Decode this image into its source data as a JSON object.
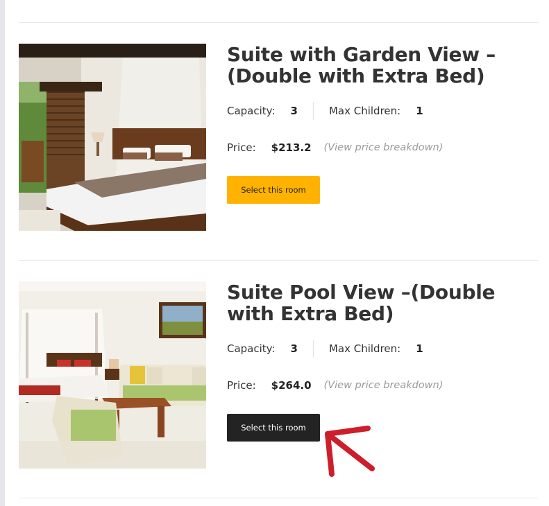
{
  "rooms": [
    {
      "title": "Suite with Garden View –(Double with Extra Bed)",
      "capacity_label": "Capacity:",
      "capacity_value": "3",
      "max_children_label": "Max Children:",
      "max_children_value": "1",
      "price_label": "Price:",
      "price_value": "$213.2",
      "breakdown_link": "(View price breakdown)",
      "button_label": "Select this room",
      "button_color": "#ffb300"
    },
    {
      "title": "Suite Pool View –(Double with Extra Bed)",
      "capacity_label": "Capacity:",
      "capacity_value": "3",
      "max_children_label": "Max Children:",
      "max_children_value": "1",
      "price_label": "Price:",
      "price_value": "$264.0",
      "breakdown_link": "(View price breakdown)",
      "button_label": "Select this room",
      "button_color": "#232323"
    }
  ],
  "annotation": {
    "icon": "red-arrow-icon",
    "color": "#cc1f2b"
  }
}
